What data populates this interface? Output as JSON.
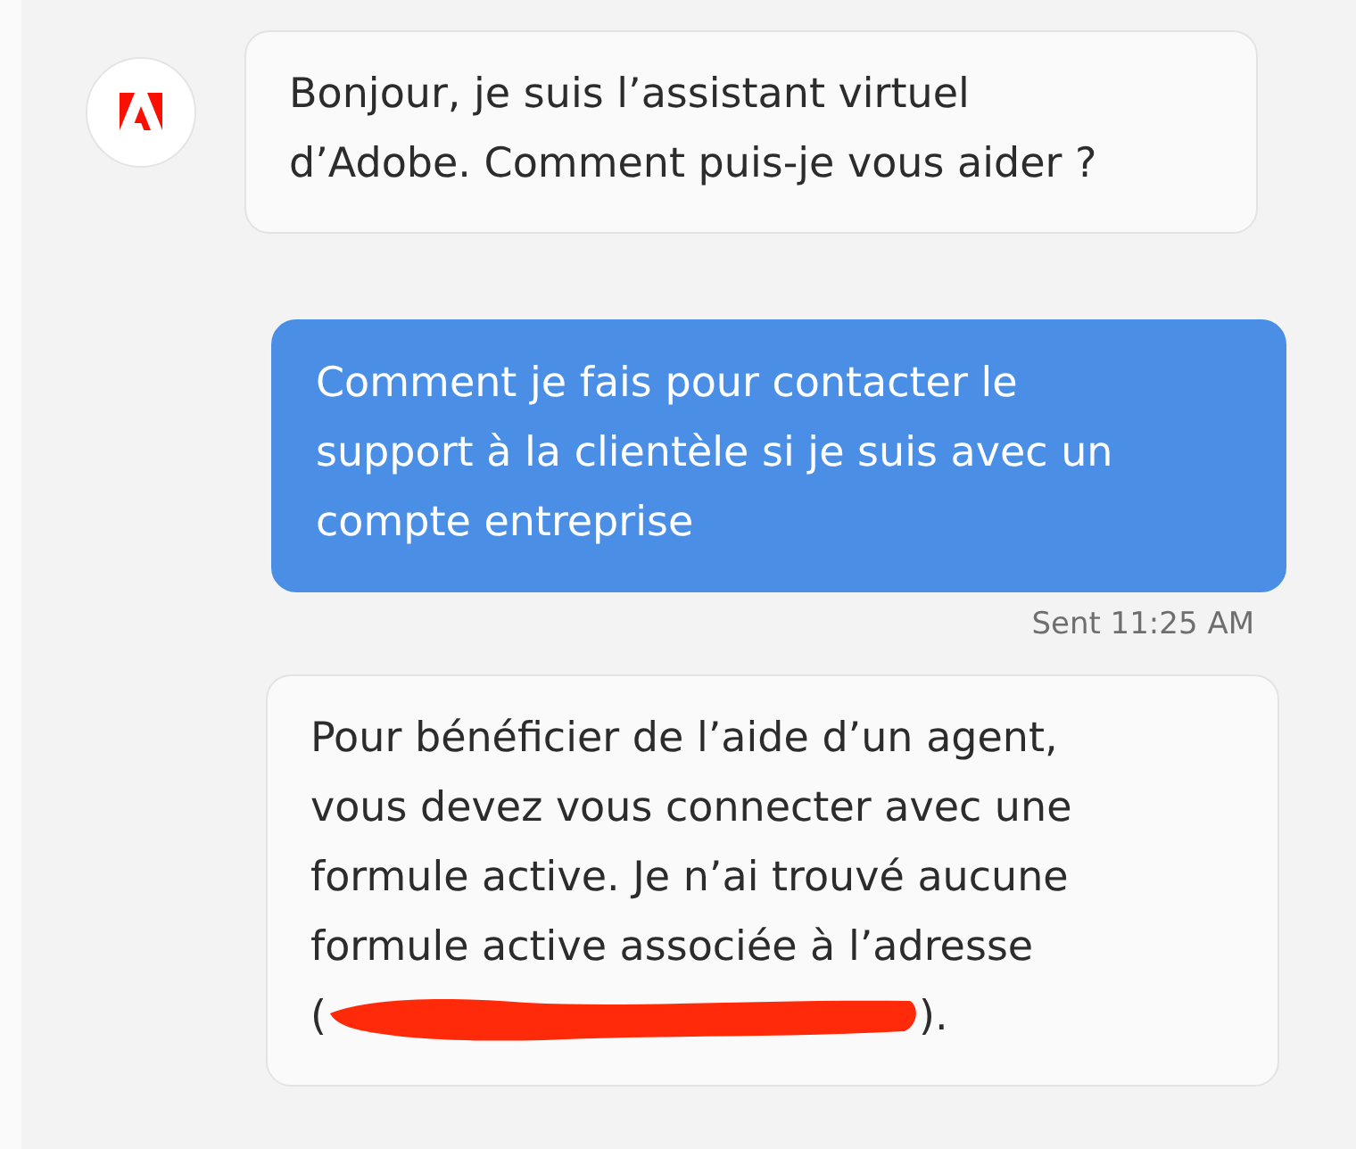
{
  "messages": [
    {
      "kind": "bot",
      "lines": [
        "Bonjour, je suis l’assistant virtuel",
        "d’Adobe. Comment puis-je vous aider ?"
      ]
    },
    {
      "kind": "user",
      "lines": [
        "Comment je fais pour contacter le",
        "support à la clientèle si je suis avec un",
        "compte entreprise"
      ],
      "status": "Sent 11:25 AM"
    },
    {
      "kind": "bot_redacted",
      "lines": [
        "Pour bénéficier de l’aide d’un agent,",
        "vous devez vous connecter avec une",
        "formule active. Je n’ai trouvé aucune",
        "formule active associée à l’adresse"
      ],
      "open": "(",
      "close": ")."
    }
  ]
}
